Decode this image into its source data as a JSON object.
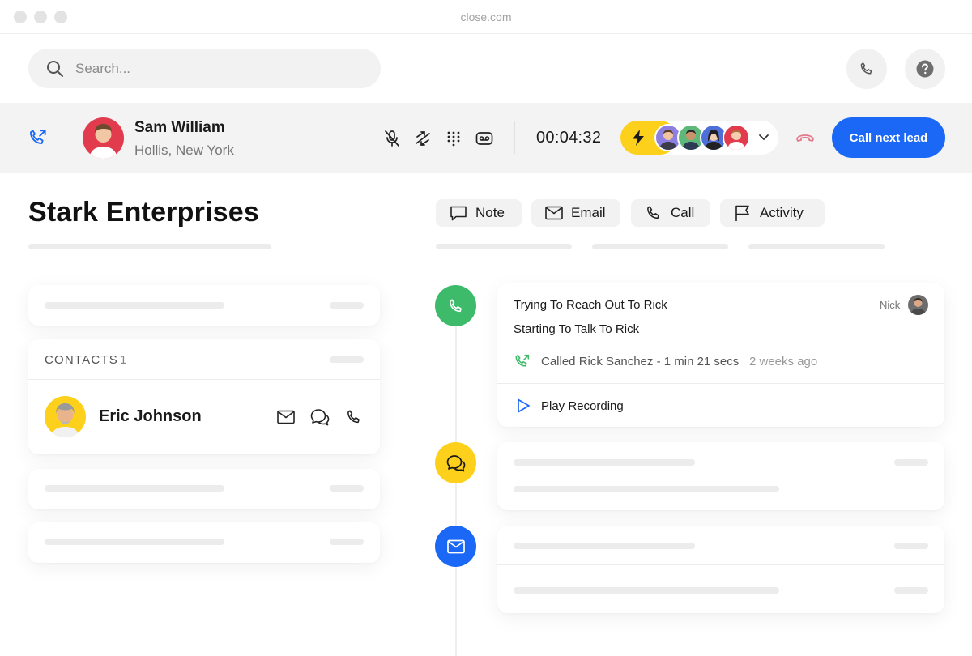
{
  "window": {
    "url": "close.com"
  },
  "search": {
    "placeholder": "Search..."
  },
  "call_bar": {
    "caller_name": "Sam William",
    "caller_location": "Hollis, New York",
    "timer": "00:04:32",
    "cta_label": "Call next lead"
  },
  "lead": {
    "title": "Stark Enterprises"
  },
  "contacts": {
    "header": "CONTACTS",
    "count": "1",
    "items": [
      {
        "name": "Eric Johnson"
      }
    ]
  },
  "tabs": [
    {
      "label": "Note",
      "icon": "note-icon"
    },
    {
      "label": "Email",
      "icon": "email-icon"
    },
    {
      "label": "Call",
      "icon": "phone-icon"
    },
    {
      "label": "Activity",
      "icon": "flag-icon"
    }
  ],
  "activity": {
    "line1": "Trying To Reach Out To Rick",
    "line2": "Starting To Talk To Rick",
    "author": "Nick",
    "call_summary": "Called Rick Sanchez - 1 min 21 secs",
    "time_ago": "2 weeks ago",
    "play_label": "Play Recording"
  },
  "colors": {
    "accent": "#1a68f5",
    "call_node": "#3ebb6a",
    "sms_node": "#fcd01b",
    "email_node": "#1a68f5",
    "bolt": "#fcd01b",
    "hangup": "#e2798a"
  }
}
